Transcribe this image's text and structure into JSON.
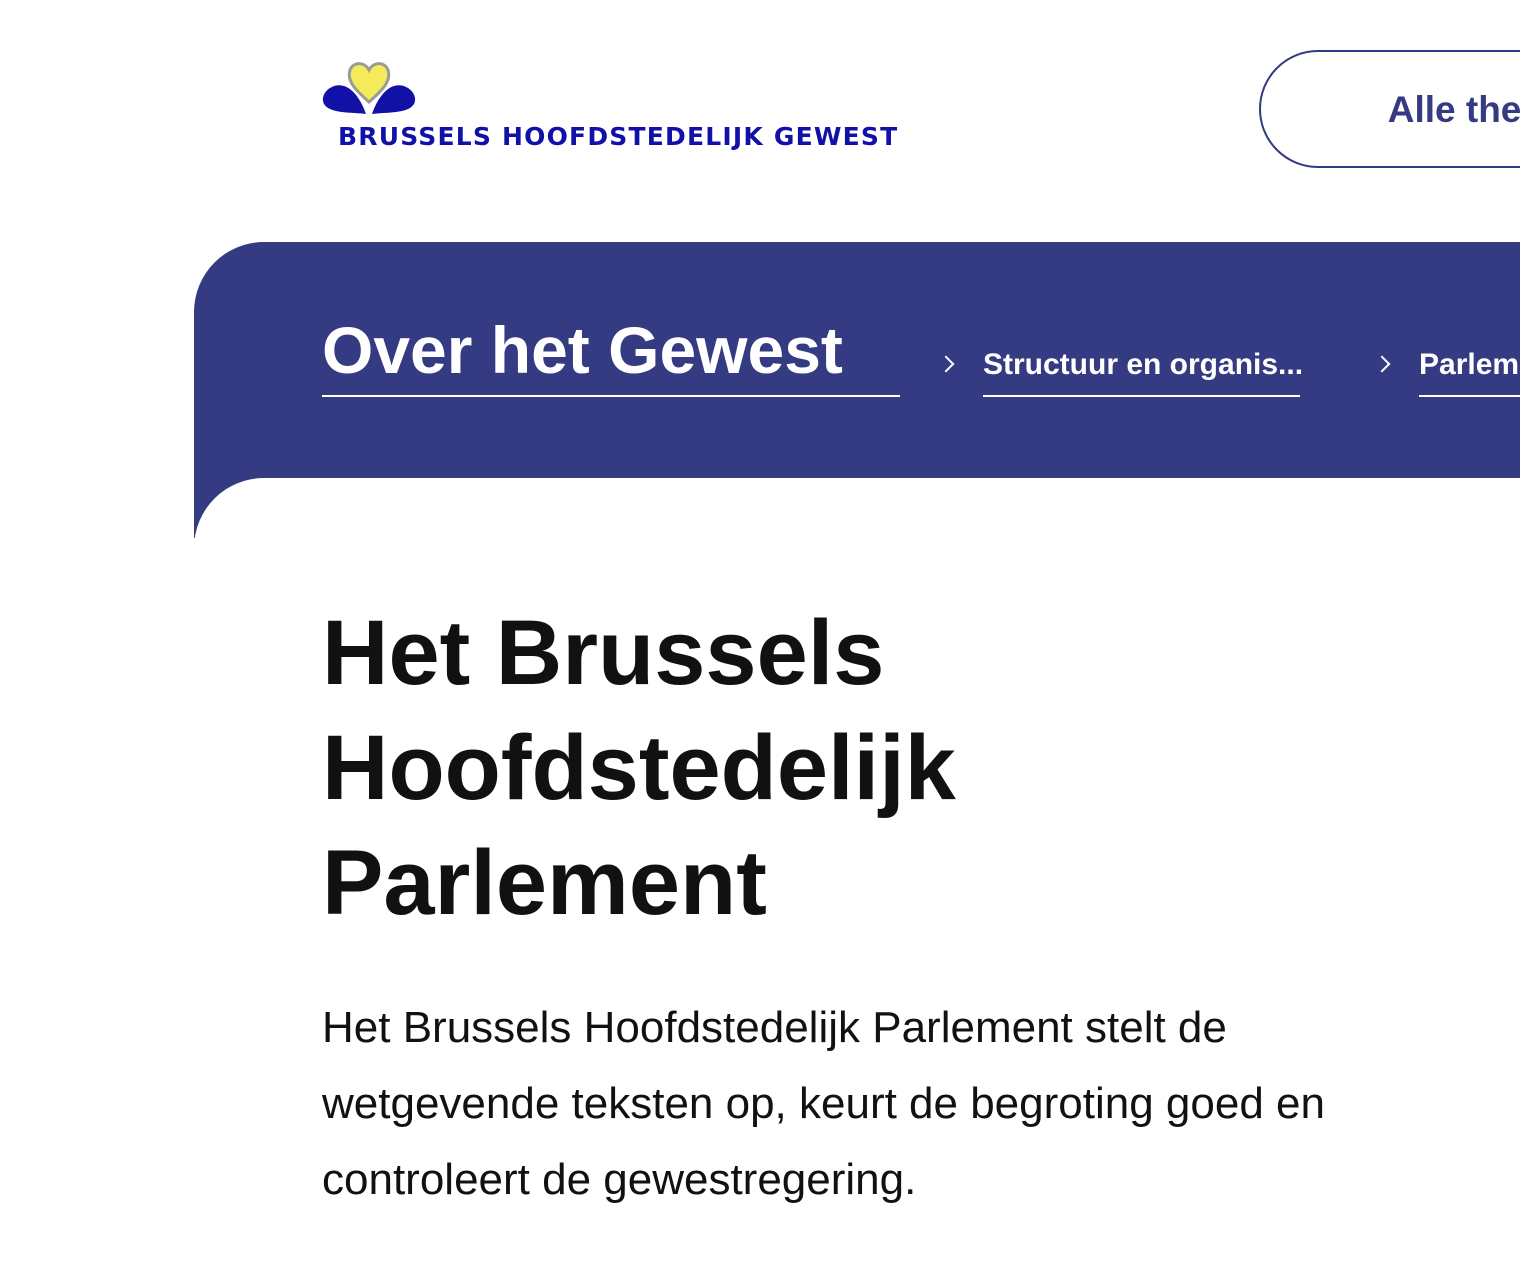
{
  "header": {
    "logo_text": "BRUSSELS HOOFDSTEDELIJK GEWEST",
    "themes_button_label": "Alle thema's"
  },
  "breadcrumb": {
    "items": [
      {
        "label": "Over het Gewest"
      },
      {
        "label": "Structuur en organis..."
      },
      {
        "label": "Parlement"
      }
    ]
  },
  "main": {
    "title": "Het Brussels Hoofdstedelijk Parlement",
    "intro": "Het Brussels Hoofdstedelijk Parlement stelt de wetgevende teksten op, keurt de begroting goed en controleert de gewestregering."
  },
  "colors": {
    "brand_blue": "#343b82",
    "logo_blue": "#1111a8",
    "logo_yellow": "#f5ea5a"
  },
  "icons": [
    "brussels-logo-icon",
    "chevron-right-icon"
  ]
}
